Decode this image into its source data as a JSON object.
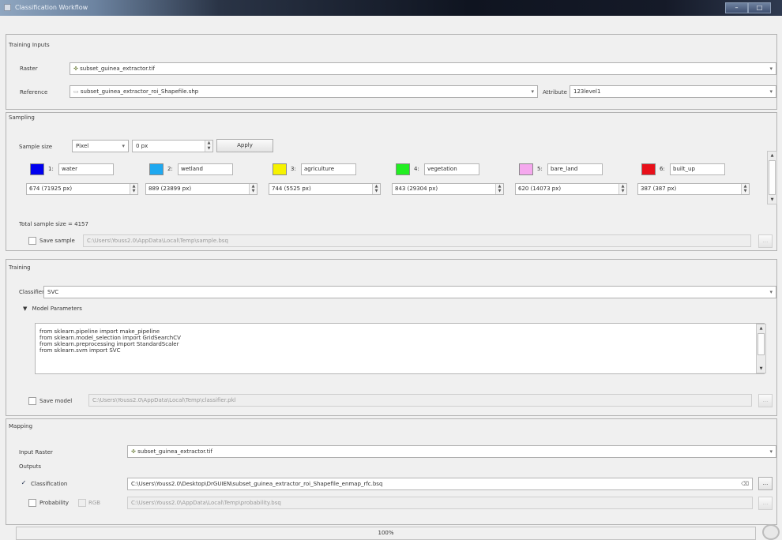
{
  "window": {
    "title": "Classification Workflow",
    "controls": [
      "–",
      "□"
    ]
  },
  "training_inputs": {
    "title": "Training Inputs",
    "raster_label": "Raster",
    "raster_value": "subset_guinea_extractor.tif",
    "reference_label": "Reference",
    "reference_value": "subset_guinea_extractor_roi_Shapefile.shp",
    "attribute_label": "Attribute",
    "attribute_value": "123level1"
  },
  "sampling": {
    "title": "Sampling",
    "sample_size_label": "Sample size",
    "unit_value": "Pixel",
    "size_value": "0 px",
    "apply_label": "Apply",
    "classes": [
      {
        "index": "1:",
        "name": "water",
        "count": "674 (71925 px)",
        "color": "#0000ee"
      },
      {
        "index": "2:",
        "name": "wetland",
        "count": "889 (23899 px)",
        "color": "#1ea8f0"
      },
      {
        "index": "3:",
        "name": "agriculture",
        "count": "744 (5525 px)",
        "color": "#f6f200"
      },
      {
        "index": "4:",
        "name": "vegetation",
        "count": "843 (29304 px)",
        "color": "#22ee22"
      },
      {
        "index": "5:",
        "name": "bare_land",
        "count": "620 (14073 px)",
        "color": "#f5a8ee"
      },
      {
        "index": "6:",
        "name": "built_up",
        "count": "387 (387 px)",
        "color": "#e8101a"
      }
    ],
    "total_label": "Total sample size = 4157",
    "save_sample_label": "Save sample",
    "save_sample_path": "C:\\Users\\Youss2.0\\AppData\\Local\\Temp\\sample.bsq",
    "browse_label": "..."
  },
  "training": {
    "title": "Training",
    "classifier_label": "Classifier",
    "classifier_value": "SVC",
    "model_params_label": "Model Parameters",
    "code_lines": [
      "from sklearn.pipeline import make_pipeline",
      "from sklearn.model_selection import GridSearchCV",
      "from sklearn.preprocessing import StandardScaler",
      "from sklearn.svm import SVC"
    ],
    "save_model_label": "Save model",
    "save_model_path": "C:\\Users\\Youss2.0\\AppData\\Local\\Temp\\classifier.pkl",
    "browse_label": "..."
  },
  "mapping": {
    "title": "Mapping",
    "input_raster_label": "Input Raster",
    "input_raster_value": "subset_guinea_extractor.tif",
    "outputs_label": "Outputs",
    "classification_label": "Classification",
    "classification_checked": "✓",
    "classification_path": "C:\\Users\\Youss2.0\\Desktop\\DrGUIEN\\subset_guinea_extractor_roi_Shapefile_enmap_rfc.bsq",
    "probability_label": "Probability",
    "rgb_label": "RGB",
    "probability_path": "C:\\Users\\Youss2.0\\AppData\\Local\\Temp\\probability.bsq",
    "browse_label": "..."
  },
  "progress": {
    "text": "100%",
    "value": 1.0
  }
}
